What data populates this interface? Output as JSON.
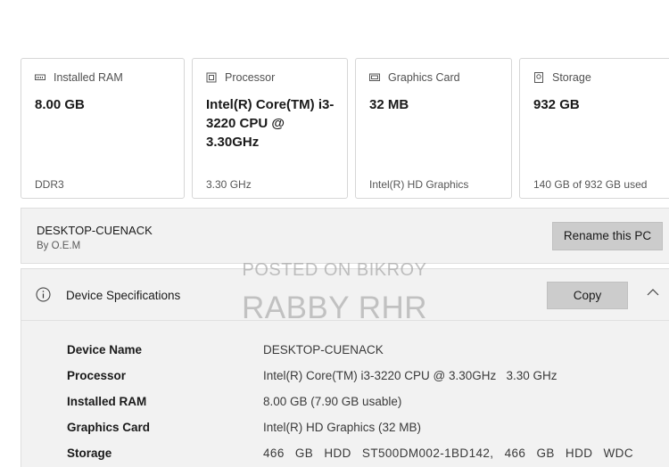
{
  "cards": [
    {
      "title": "Installed RAM",
      "icon": "memory-icon",
      "value": "8.00 GB",
      "sub": "DDR3"
    },
    {
      "title": "Processor",
      "icon": "processor-icon",
      "value": "Intel(R) Core(TM) i3-3220 CPU @ 3.30GHz",
      "sub": "3.30 GHz"
    },
    {
      "title": "Graphics Card",
      "icon": "display-icon",
      "value": "32 MB",
      "sub": "Intel(R) HD Graphics"
    },
    {
      "title": "Storage",
      "icon": "storage-icon",
      "value": "932 GB",
      "sub": "140 GB of 932 GB used"
    }
  ],
  "pc": {
    "name": "DESKTOP-CUENACK",
    "sub": "By O.E.M",
    "rename_label": "Rename this PC"
  },
  "specs": {
    "title": "Device Specifications",
    "copy_label": "Copy",
    "rows": [
      {
        "label": "Device Name",
        "value": "DESKTOP-CUENACK"
      },
      {
        "label": "Processor",
        "value": "Intel(R) Core(TM) i3-3220 CPU @ 3.30GHz   3.30 GHz"
      },
      {
        "label": "Installed RAM",
        "value": "8.00 GB (7.90 GB usable)"
      },
      {
        "label": "Graphics Card",
        "value": "Intel(R) HD Graphics (32 MB)"
      },
      {
        "label": "Storage",
        "value": "466 GB HDD ST500DM002-1BD142, 466 GB HDD WDC"
      }
    ]
  },
  "watermark": {
    "line1": "POSTED ON BIKROY",
    "line2": "RABBY RHR"
  }
}
